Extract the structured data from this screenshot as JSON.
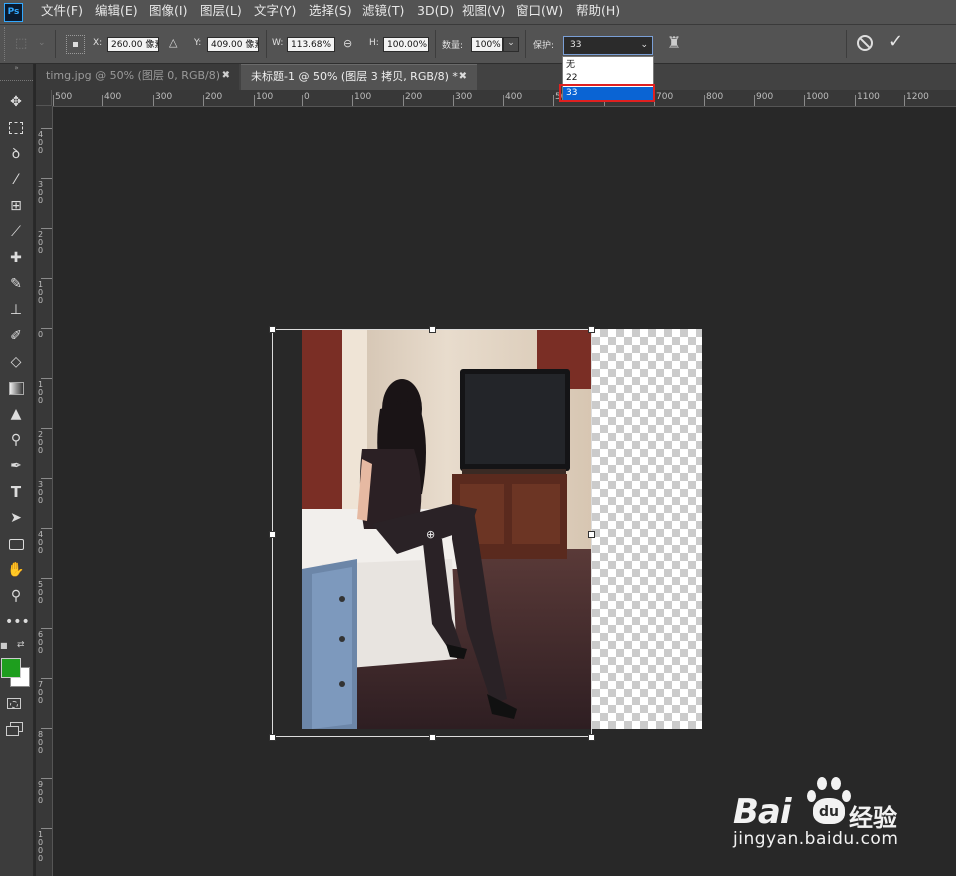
{
  "app": {
    "logo": "Ps"
  },
  "menu": [
    "文件(F)",
    "编辑(E)",
    "图像(I)",
    "图层(L)",
    "文字(Y)",
    "选择(S)",
    "滤镜(T)",
    "3D(D)",
    "视图(V)",
    "窗口(W)",
    "帮助(H)"
  ],
  "options": {
    "x_label": "X:",
    "x_value": "260.00 像素",
    "y_label": "Y:",
    "y_value": "409.00 像素",
    "w_label": "W:",
    "w_value": "113.68%",
    "h_label": "H:",
    "h_value": "100.00%",
    "amount_label": "数量:",
    "amount_value": "100%",
    "protect_label": "保护:",
    "protect_value": "33",
    "protect_options": [
      "无",
      "22",
      "33"
    ]
  },
  "tabs": [
    {
      "label": "timg.jpg @ 50% (图层 0, RGB/8) *",
      "active": false
    },
    {
      "label": "未标题-1 @ 50% (图层 3 拷贝, RGB/8) *",
      "active": true
    }
  ],
  "ruler": {
    "h_ticks": [
      "500",
      "400",
      "300",
      "200",
      "100",
      "0",
      "100",
      "200",
      "300",
      "400",
      "500",
      "600",
      "700",
      "800",
      "900",
      "1000",
      "1100",
      "1200"
    ],
    "v_ticks": [
      "400",
      "300",
      "200",
      "100",
      "0",
      "100",
      "200",
      "300",
      "400",
      "500",
      "600",
      "700",
      "800",
      "900",
      "1000"
    ]
  },
  "toolbar": {
    "icons": [
      "move-icon",
      "marquee-icon",
      "lasso-icon",
      "magic-wand-icon",
      "crop-icon",
      "eyedropper-icon",
      "healing-brush-icon",
      "brush-icon",
      "clone-stamp-icon",
      "history-brush-icon",
      "eraser-icon",
      "gradient-icon",
      "blur-icon",
      "dodge-icon",
      "pen-icon",
      "type-icon",
      "path-selection-icon",
      "shape-icon",
      "hand-icon",
      "zoom-icon",
      "more-tools-icon"
    ],
    "fg_color": "#1e9e1e",
    "bg_color": "#ffffff",
    "type_glyph": "T"
  },
  "watermark": {
    "brand": "Bai",
    "brand2": "du",
    "product": "经验",
    "url": "jingyan.baidu.com"
  }
}
